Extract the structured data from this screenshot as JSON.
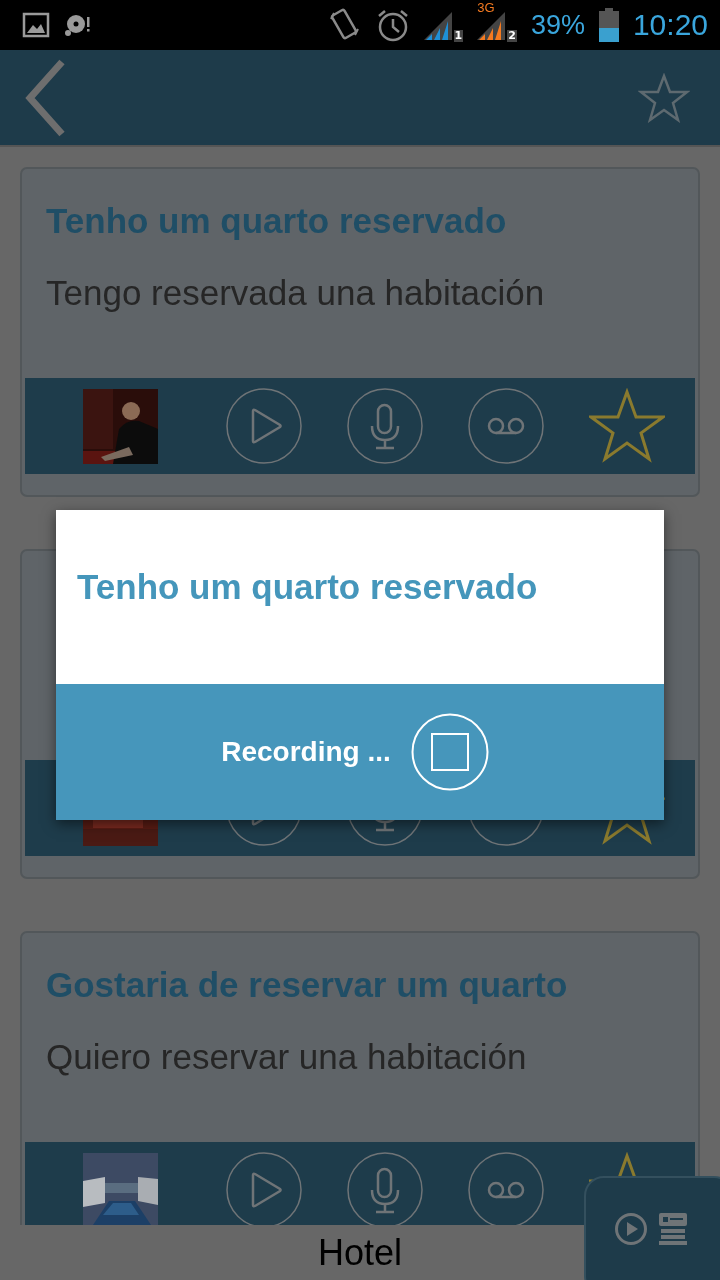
{
  "status_bar": {
    "network": "3G",
    "sim_1": "1",
    "sim_2": "2",
    "battery": "39%",
    "time": "10:20"
  },
  "cards": [
    {
      "title": "Tenho um quarto reservado",
      "translation": "Tengo reservada una habitación",
      "favorite": false
    },
    {
      "favorite": false
    },
    {
      "title": "Gostaria de reservar um quarto",
      "translation": "Quiero reservar una habitación",
      "favorite": false
    }
  ],
  "dialog": {
    "title": "Tenho um quarto reservado",
    "status": "Recording ..."
  },
  "footer": {
    "title": "Hotel"
  }
}
